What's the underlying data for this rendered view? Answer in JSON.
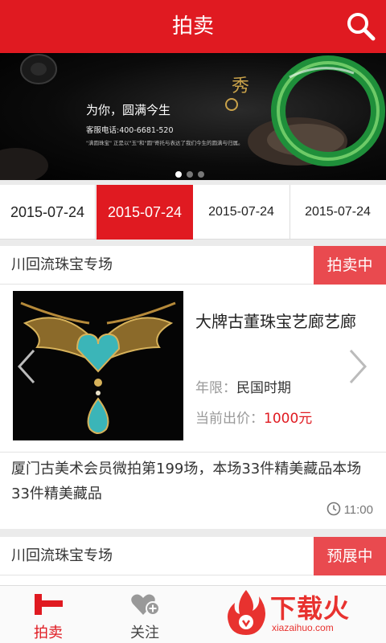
{
  "header": {
    "title": "拍卖"
  },
  "banner": {
    "headline": "为你，圆满今生",
    "phone": "客服电话:400-6681-520",
    "desc": "\"满圆珠宝\" 正是以\"玉\"和\"圆\"寄托与表达了我们今生的圆满与归属。",
    "slides_total": 3,
    "slide_active": 1
  },
  "dates": [
    "2015-07-24",
    "2015-07-24",
    "2015-07-24",
    "2015-07-24"
  ],
  "card1": {
    "venue": "川回流珠宝专场",
    "status": "拍卖中",
    "item_name": "大牌古董珠宝艺廊艺廊",
    "era_label": "年限：",
    "era_value": "民国时期",
    "price_label": "当前出价：",
    "price_value": "1000元",
    "description": "厦门古美术会员微拍第199场，本场33件精美藏品本场33件精美藏品",
    "time": "11:00"
  },
  "card2": {
    "venue": "川回流珠宝专场",
    "status": "预展中"
  },
  "tabbar": {
    "tabs": [
      {
        "label": "拍卖",
        "icon": "gavel-icon",
        "active": true
      },
      {
        "label": "关注",
        "icon": "heart-plus-icon",
        "active": false
      },
      {
        "label": "",
        "icon": "tab-icon",
        "active": false
      }
    ]
  },
  "watermark": {
    "text": "下载火",
    "url": "xiazaihuo.com"
  },
  "colors": {
    "brand_red": "#e01a21",
    "status_red": "#e94a4f",
    "price_red": "#e01a21"
  }
}
